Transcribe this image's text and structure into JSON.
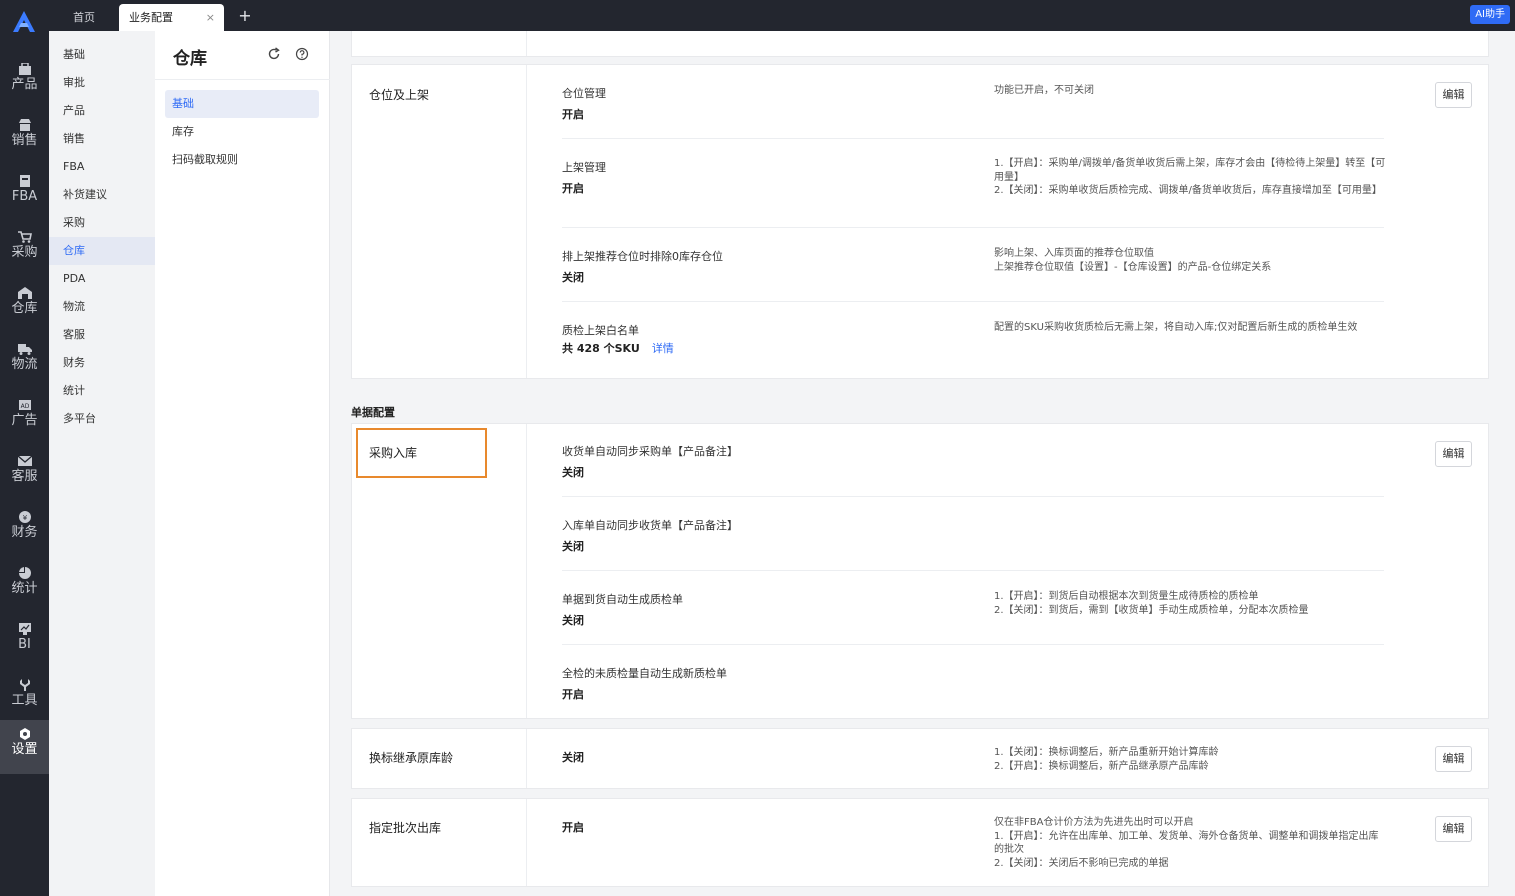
{
  "rail": {
    "items": [
      {
        "label": "产品",
        "icon": "product-icon"
      },
      {
        "label": "销售",
        "icon": "sales-icon"
      },
      {
        "label": "FBA",
        "icon": "fba-icon"
      },
      {
        "label": "采购",
        "icon": "purchase-cart-icon"
      },
      {
        "label": "仓库",
        "icon": "warehouse-icon"
      },
      {
        "label": "物流",
        "icon": "truck-icon"
      },
      {
        "label": "广告",
        "icon": "ad-icon"
      },
      {
        "label": "客服",
        "icon": "mail-icon"
      },
      {
        "label": "财务",
        "icon": "finance-icon"
      },
      {
        "label": "统计",
        "icon": "pie-chart-icon"
      },
      {
        "label": "BI",
        "icon": "bi-chart-icon"
      },
      {
        "label": "工具",
        "icon": "tools-icon"
      },
      {
        "label": "设置",
        "icon": "settings-icon"
      }
    ]
  },
  "tabs": {
    "home": "首页",
    "current": "业务配置",
    "close": "×",
    "add": "+",
    "ai_button": "AI助手"
  },
  "nav2": {
    "items": [
      "基础",
      "审批",
      "产品",
      "销售",
      "FBA",
      "补货建议",
      "采购",
      "仓库",
      "PDA",
      "物流",
      "客服",
      "财务",
      "统计",
      "多平台"
    ],
    "active": "仓库"
  },
  "nav3": {
    "title": "仓库",
    "items": [
      "基础",
      "库存",
      "扫码截取规则"
    ],
    "active": "基础"
  },
  "main": {
    "edit_label": "编辑",
    "slotting": {
      "title": "仓位及上架",
      "rows": [
        {
          "title": "仓位管理",
          "value": "开启",
          "desc": [
            "功能已开启，不可关闭"
          ]
        },
        {
          "title": "上架管理",
          "value": "开启",
          "desc": [
            "1.【开启】：采购单/调拨单/备货单收货后需上架，库存才会由【待检待上架量】转至【可用量】",
            "2.【关闭】：采购单收货后质检完成、调拨单/备货单收货后，库存直接增加至【可用量】"
          ]
        },
        {
          "title": "排上架推荐仓位时排除0库存仓位",
          "value": "关闭",
          "desc": [
            "影响上架、入库页面的推荐仓位取值",
            "上架推荐仓位取值【设置】-【仓库设置】的产品-仓位绑定关系"
          ]
        },
        {
          "title": "质检上架白名单",
          "value": "共 428 个SKU",
          "link": "详情",
          "desc": [
            "配置的SKU采购收货质检后无需上架，将自动入库;仅对配置后新生成的质检单生效"
          ]
        }
      ]
    },
    "doc_config_label": "单据配置",
    "purchase_inbound": {
      "title": "采购入库",
      "rows": [
        {
          "title": "收货单自动同步采购单【产品备注】",
          "value": "关闭",
          "desc": []
        },
        {
          "title": "入库单自动同步收货单【产品备注】",
          "value": "关闭",
          "desc": []
        },
        {
          "title": "单据到货自动生成质检单",
          "value": "关闭",
          "desc": [
            "1.【开启】：到货后自动根据本次到货量生成待质检的质检单",
            "2.【关闭】：到货后，需到【收货单】手动生成质检单，分配本次质检量"
          ]
        },
        {
          "title": "全检的未质检量自动生成新质检单",
          "value": "开启",
          "desc": []
        }
      ]
    },
    "relabel_age": {
      "title": "换标继承原库龄",
      "value": "关闭",
      "desc": [
        "1.【关闭】：换标调整后，新产品重新开始计算库龄",
        "2.【开启】：换标调整后，新产品继承原产品库龄"
      ]
    },
    "batch_out": {
      "title": "指定批次出库",
      "value": "开启",
      "desc": [
        "仅在非FBA仓计价方法为先进先出时可以开启",
        "1.【开启】：允许在出库单、加工单、发货单、海外仓备货单、调整单和调拨单指定出库的批次",
        "2.【关闭】：关闭后不影响已完成的单据"
      ]
    }
  }
}
